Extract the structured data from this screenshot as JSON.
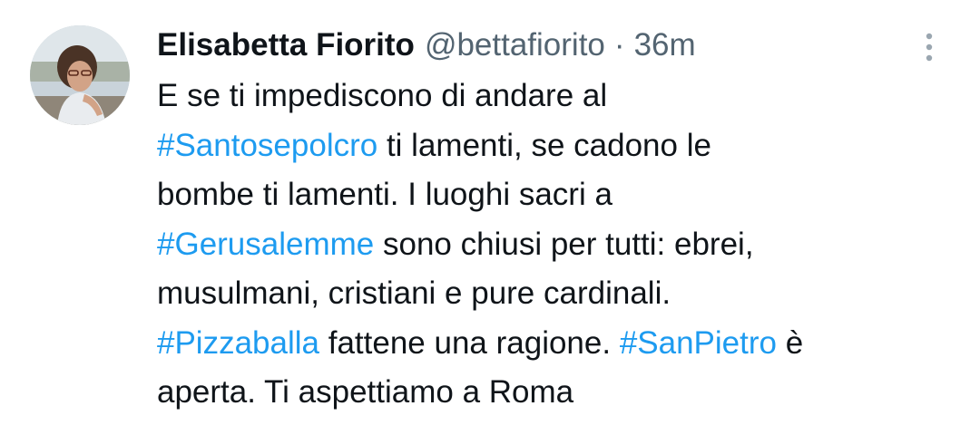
{
  "author": {
    "name": "Elisabetta Fiorito",
    "handle": "@bettafiorito",
    "separator": "·",
    "timestamp": "36m"
  },
  "icons": {
    "more": "more-vertical-icon",
    "avatar": "profile-photo"
  },
  "colors": {
    "text": "#0f1419",
    "secondary": "#536471",
    "hashtag": "#1d9bf0",
    "background": "#ffffff"
  },
  "tweet": {
    "lines": [
      [
        {
          "t": "E se ti impediscono di andare al"
        }
      ],
      [
        {
          "t": "#Santosepolcro",
          "tag": true
        },
        {
          "t": " ti lamenti, se cadono le"
        }
      ],
      [
        {
          "t": "bombe ti lamenti. I luoghi sacri a"
        }
      ],
      [
        {
          "t": "#Gerusalemme",
          "tag": true
        },
        {
          "t": " sono chiusi per tutti: ebrei,"
        }
      ],
      [
        {
          "t": "musulmani, cristiani e pure cardinali."
        }
      ],
      [
        {
          "t": "#Pizzaballa",
          "tag": true
        },
        {
          "t": " fattene una ragione. "
        },
        {
          "t": "#SanPietro",
          "tag": true
        },
        {
          "t": " è"
        }
      ],
      [
        {
          "t": "aperta. Ti aspettiamo a Roma"
        }
      ]
    ]
  }
}
